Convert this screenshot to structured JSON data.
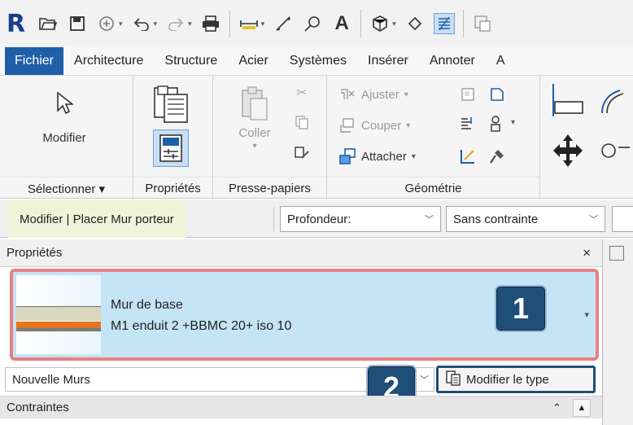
{
  "qat": {
    "logo": "R",
    "text_tool": "A"
  },
  "tabs": [
    "Fichier",
    "Architecture",
    "Structure",
    "Acier",
    "Systèmes",
    "Insérer",
    "Annoter",
    "A"
  ],
  "ribbon": {
    "modify": {
      "label": "Modifier",
      "panel": "Sélectionner ▾"
    },
    "properties_panel": {
      "label": "Propriétés"
    },
    "clipboard": {
      "paste_label": "Coller",
      "panel": "Presse-papiers"
    },
    "geometry": {
      "join": "Ajuster",
      "cut": "Couper",
      "attach": "Attacher",
      "panel": "Géométrie"
    }
  },
  "options_bar": {
    "context_label": "Modifier | Placer Mur porteur",
    "depth_value": "Profondeur:",
    "constraint_value": "Sans contrainte"
  },
  "properties": {
    "title": "Propriétés",
    "close": "×",
    "type_family": "Mur de base",
    "type_name": "M1 enduit 2 +BBMC 20+  iso 10",
    "instance_filter": "Nouvelle Murs",
    "edit_type_label": "Modifier le type",
    "section": "Contraintes"
  },
  "badges": {
    "one": "1",
    "two": "2"
  },
  "colors": {
    "file_tab": "#1f5fa8",
    "type_selector_bg": "#c5e4f5",
    "highlight_border": "#e98080",
    "badge_bg": "#1f4e79"
  }
}
